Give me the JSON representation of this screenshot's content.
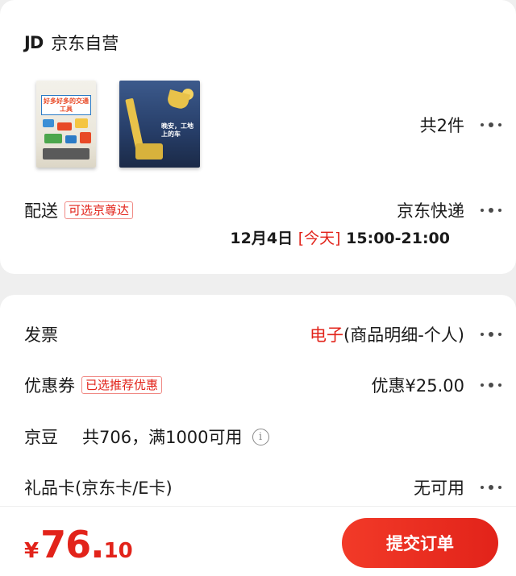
{
  "store": {
    "logo": "JD",
    "name": "京东自营",
    "item_count": "共2件",
    "books": [
      {
        "title": "好多好多的交通工具"
      },
      {
        "title": "晚安，工地上的车"
      }
    ]
  },
  "delivery": {
    "label": "配送",
    "tag": "可选京尊达",
    "method": "京东快递",
    "date": "12月4日",
    "today": "[今天]",
    "time": "15:00-21:00"
  },
  "invoice": {
    "label": "发票",
    "type": "电子",
    "detail": "(商品明细-个人)"
  },
  "coupon": {
    "label": "优惠券",
    "tag": "已选推荐优惠",
    "value": "优惠¥25.00"
  },
  "jd_beans": {
    "label": "京豆",
    "detail": "共706，满1000可用",
    "info_icon": "i"
  },
  "gift_card": {
    "label": "礼品卡(京东卡/E卡)",
    "value": "无可用"
  },
  "footer": {
    "currency": "¥",
    "price_int": "76.",
    "price_dec": "10",
    "submit_label": "提交订单"
  },
  "colors": {
    "accent": "#e2231a",
    "background": "#efefef"
  }
}
